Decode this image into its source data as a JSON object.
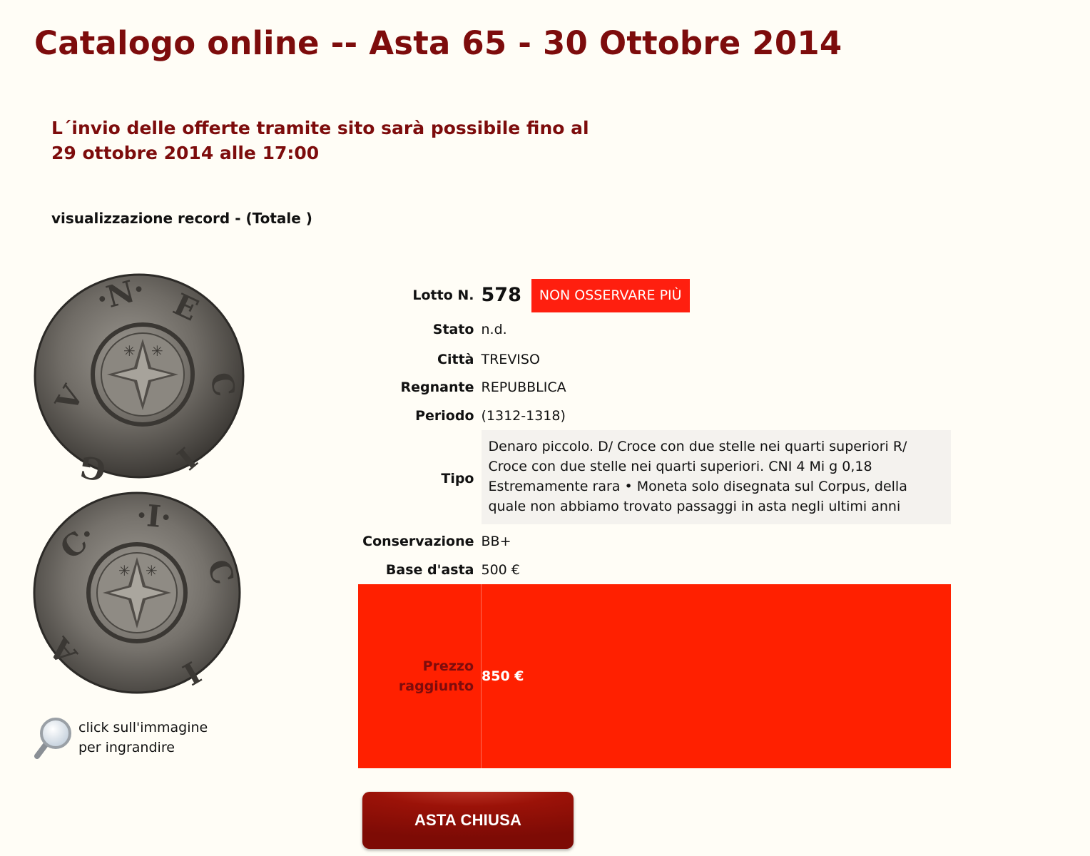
{
  "header": {
    "title": "Catalogo online -- Asta 65 - 30 Ottobre 2014"
  },
  "notice": {
    "line1": "L´invio delle offerte tramite sito sarà possibile fino al",
    "line2": "29 ottobre 2014 alle 17:00"
  },
  "records_label": "visualizzazione record - (Totale )",
  "image": {
    "zoom_hint_line1": "click sull'immagine",
    "zoom_hint_line2": "per ingrandire"
  },
  "lot": {
    "lot_label": "Lotto N.",
    "lot_number": "578",
    "unwatch_button": "NON OSSERVARE PIÙ",
    "fields": [
      {
        "label": "Stato",
        "value": "n.d."
      },
      {
        "label": "Città",
        "value": "TREVISO"
      },
      {
        "label": "Regnante",
        "value": "REPUBBLICA"
      },
      {
        "label": "Periodo",
        "value": "(1312-1318)"
      }
    ],
    "tipo_label": "Tipo",
    "tipo_lines": [
      "Denaro piccolo. D/ Croce con due stelle nei quarti superiori R/",
      "Croce con due stelle nei quarti superiori. CNI 4 Mi g 0,18",
      "Estremamente rara • Moneta solo disegnata sul Corpus, della",
      "quale non abbiamo trovato passaggi in asta negli ultimi anni"
    ],
    "conservazione_label": "Conservazione",
    "conservazione_value": "BB+",
    "base_label": "Base d'asta",
    "base_value": "500 €",
    "price_label_line1": "Prezzo",
    "price_label_line2": "raggiunto",
    "price_value": "850 €"
  },
  "closed_button": "ASTA CHIUSA",
  "colors": {
    "title": "#7d0c0c",
    "price_bg": "#ff2000",
    "button_red": "#ff1f0f",
    "closed_button": "#8e0f07"
  }
}
